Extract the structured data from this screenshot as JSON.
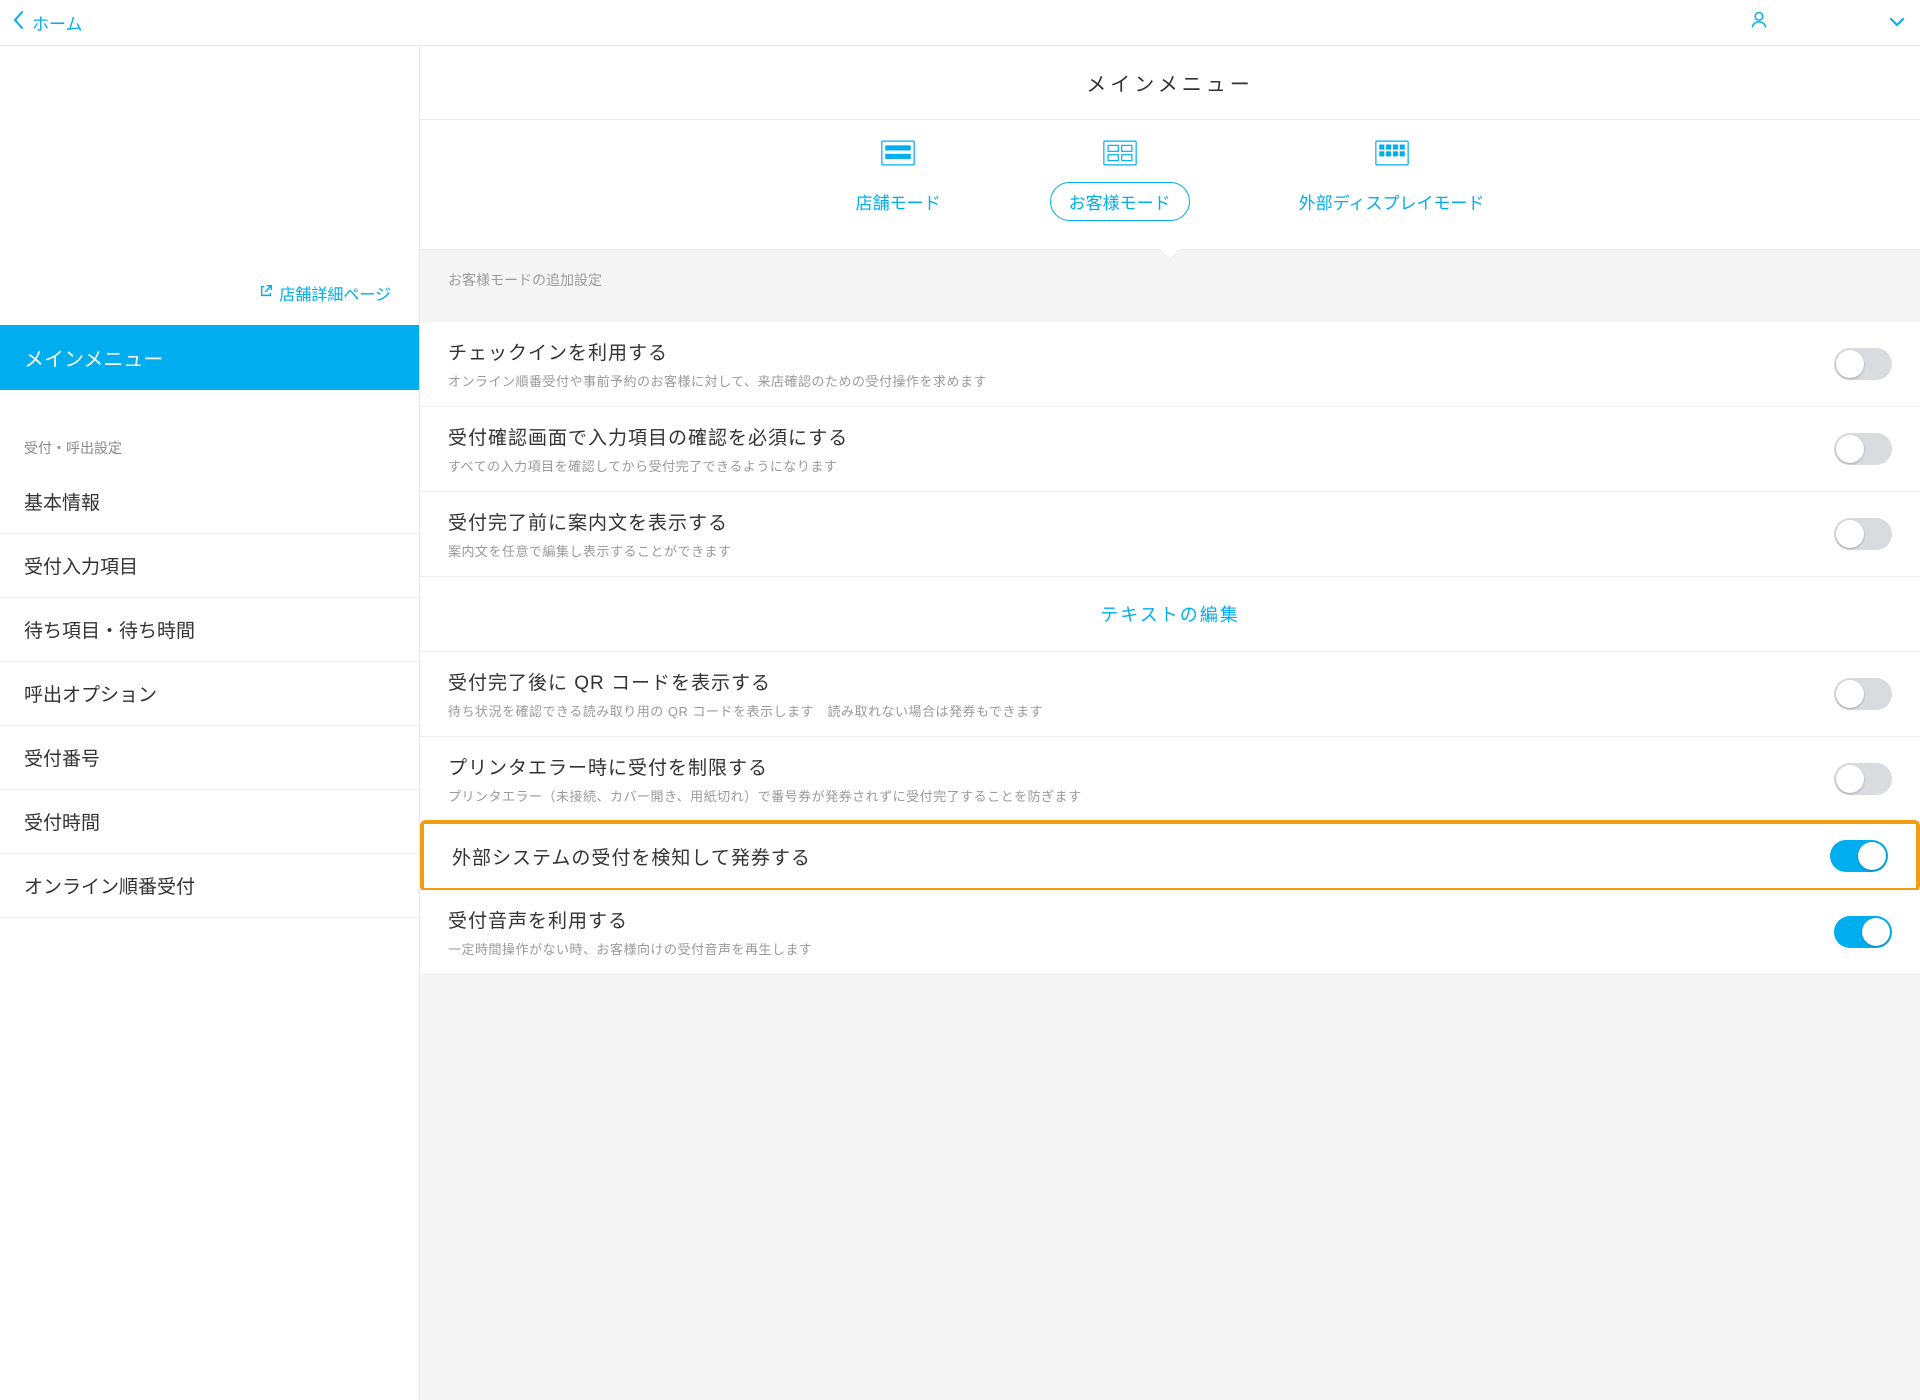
{
  "topbar": {
    "back_label": "ホーム"
  },
  "sidebar": {
    "store_detail_link": "店舗詳細ページ",
    "main_menu_label": "メインメニュー",
    "section_label": "受付・呼出設定",
    "items": [
      "基本情報",
      "受付入力項目",
      "待ち項目・待ち時間",
      "呼出オプション",
      "受付番号",
      "受付時間",
      "オンライン順番受付"
    ]
  },
  "main": {
    "title": "メインメニュー",
    "modes": {
      "store": "店舗モード",
      "customer": "お客様モード",
      "external": "外部ディスプレイモード"
    },
    "panel_caption": "お客様モードの追加設定",
    "rows": {
      "checkin": {
        "title": "チェックインを利用する",
        "desc": "オンライン順番受付や事前予約のお客様に対して、来店確認のための受付操作を求めます",
        "on": false
      },
      "confirm_required": {
        "title": "受付確認画面で入力項目の確認を必須にする",
        "desc": "すべての入力項目を確認してから受付完了できるようになります",
        "on": false
      },
      "pre_guide": {
        "title": "受付完了前に案内文を表示する",
        "desc": "案内文を任意で編集し表示することができます",
        "on": false
      },
      "text_edit_link": "テキストの編集",
      "qr": {
        "title": "受付完了後に QR コードを表示する",
        "desc": "待ち状況を確認できる読み取り用の QR コードを表示します　読み取れない場合は発券もできます",
        "on": false
      },
      "printer_error": {
        "title": "プリンタエラー時に受付を制限する",
        "desc": "プリンタエラー（未接続、カバー開き、用紙切れ）で番号券が発券されずに受付完了することを防ぎます",
        "on": false
      },
      "external_detect": {
        "title": "外部システムの受付を検知して発券する",
        "desc": "",
        "on": true
      },
      "voice": {
        "title": "受付音声を利用する",
        "desc": "一定時間操作がない時、お客様向けの受付音声を再生します",
        "on": true
      }
    }
  }
}
